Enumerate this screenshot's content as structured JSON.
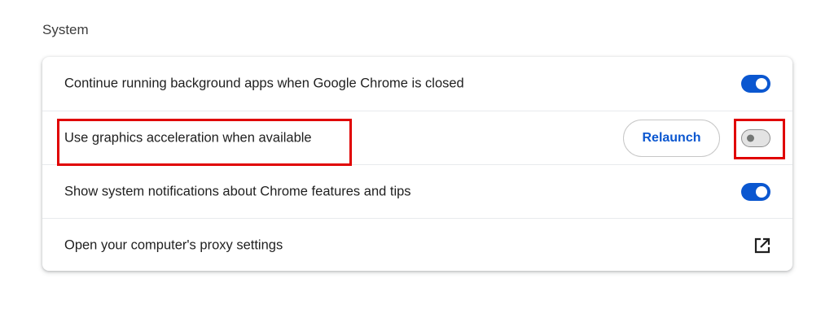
{
  "section": {
    "title": "System"
  },
  "settings": {
    "rows": [
      {
        "label": "Continue running background apps when Google Chrome is closed",
        "control": "toggle",
        "enabled": true
      },
      {
        "label": "Use graphics acceleration when available",
        "control": "toggle",
        "enabled": false,
        "button_label": "Relaunch"
      },
      {
        "label": "Show system notifications about Chrome features and tips",
        "control": "toggle",
        "enabled": true
      },
      {
        "label": "Open your computer's proxy settings",
        "control": "external-link",
        "icon": "open-in-new-icon"
      }
    ]
  },
  "colors": {
    "accent": "#0b57d0",
    "highlight": "#e00000",
    "toggle_off": "#e3e3e3"
  }
}
